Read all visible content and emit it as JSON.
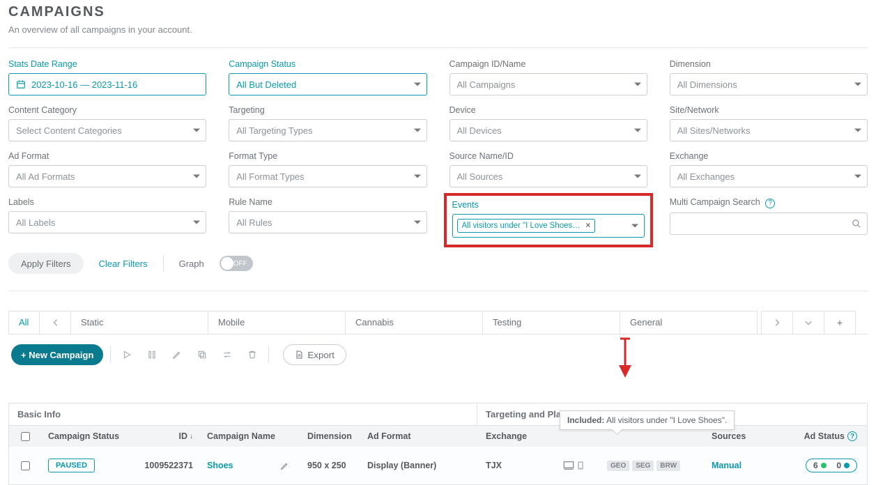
{
  "header": {
    "title": "CAMPAIGNS",
    "subtitle": "An overview of all campaigns in your account."
  },
  "filters": {
    "date_range": {
      "label": "Stats Date Range",
      "value": "2023-10-16 — 2023-11-16"
    },
    "campaign_status": {
      "label": "Campaign Status",
      "value": "All But Deleted"
    },
    "campaign_id": {
      "label": "Campaign ID/Name",
      "placeholder": "All Campaigns"
    },
    "dimension": {
      "label": "Dimension",
      "placeholder": "All Dimensions"
    },
    "content_category": {
      "label": "Content Category",
      "placeholder": "Select Content Categories"
    },
    "targeting": {
      "label": "Targeting",
      "placeholder": "All Targeting Types"
    },
    "device": {
      "label": "Device",
      "placeholder": "All Devices"
    },
    "site_network": {
      "label": "Site/Network",
      "placeholder": "All Sites/Networks"
    },
    "ad_format": {
      "label": "Ad Format",
      "placeholder": "All Ad Formats"
    },
    "format_type": {
      "label": "Format Type",
      "placeholder": "All Format Types"
    },
    "source": {
      "label": "Source Name/ID",
      "placeholder": "All Sources"
    },
    "exchange": {
      "label": "Exchange",
      "placeholder": "All Exchanges"
    },
    "labels": {
      "label": "Labels",
      "placeholder": "All Labels"
    },
    "rule_name": {
      "label": "Rule Name",
      "placeholder": "All Rules"
    },
    "events": {
      "label": "Events",
      "chip_text": "All visitors under \"I Love Shoes\" for REV…"
    },
    "multi_search": {
      "label": "Multi Campaign Search"
    }
  },
  "actions": {
    "apply": "Apply Filters",
    "clear": "Clear Filters",
    "graph_label": "Graph",
    "graph_toggle": "OFF"
  },
  "tabs": {
    "all": "All",
    "static": "Static",
    "mobile": "Mobile",
    "cannabis": "Cannabis",
    "testing": "Testing",
    "general": "General"
  },
  "toolbar": {
    "new_campaign": "+ New Campaign",
    "export": "Export"
  },
  "table": {
    "group_basic": "Basic Info",
    "group_tp": "Targeting and Placement",
    "cols": {
      "status": "Campaign Status",
      "id": "ID",
      "name": "Campaign Name",
      "dimension": "Dimension",
      "format": "Ad Format",
      "exchange": "Exchange",
      "sources": "Sources",
      "adstatus": "Ad Status"
    },
    "row": {
      "status": "PAUSED",
      "id": "1009522371",
      "name": "Shoes",
      "dimension": "950 x 250",
      "format": "Display (Banner)",
      "exchange": "TJX",
      "badges": {
        "geo": "GEO",
        "seg": "SEG",
        "brw": "BRW"
      },
      "sources": "Manual",
      "adstatus_on": "6",
      "adstatus_off": "0"
    },
    "tooltip": {
      "label": "Included:",
      "value": " All visitors under \"I Love Shoes\"."
    }
  }
}
